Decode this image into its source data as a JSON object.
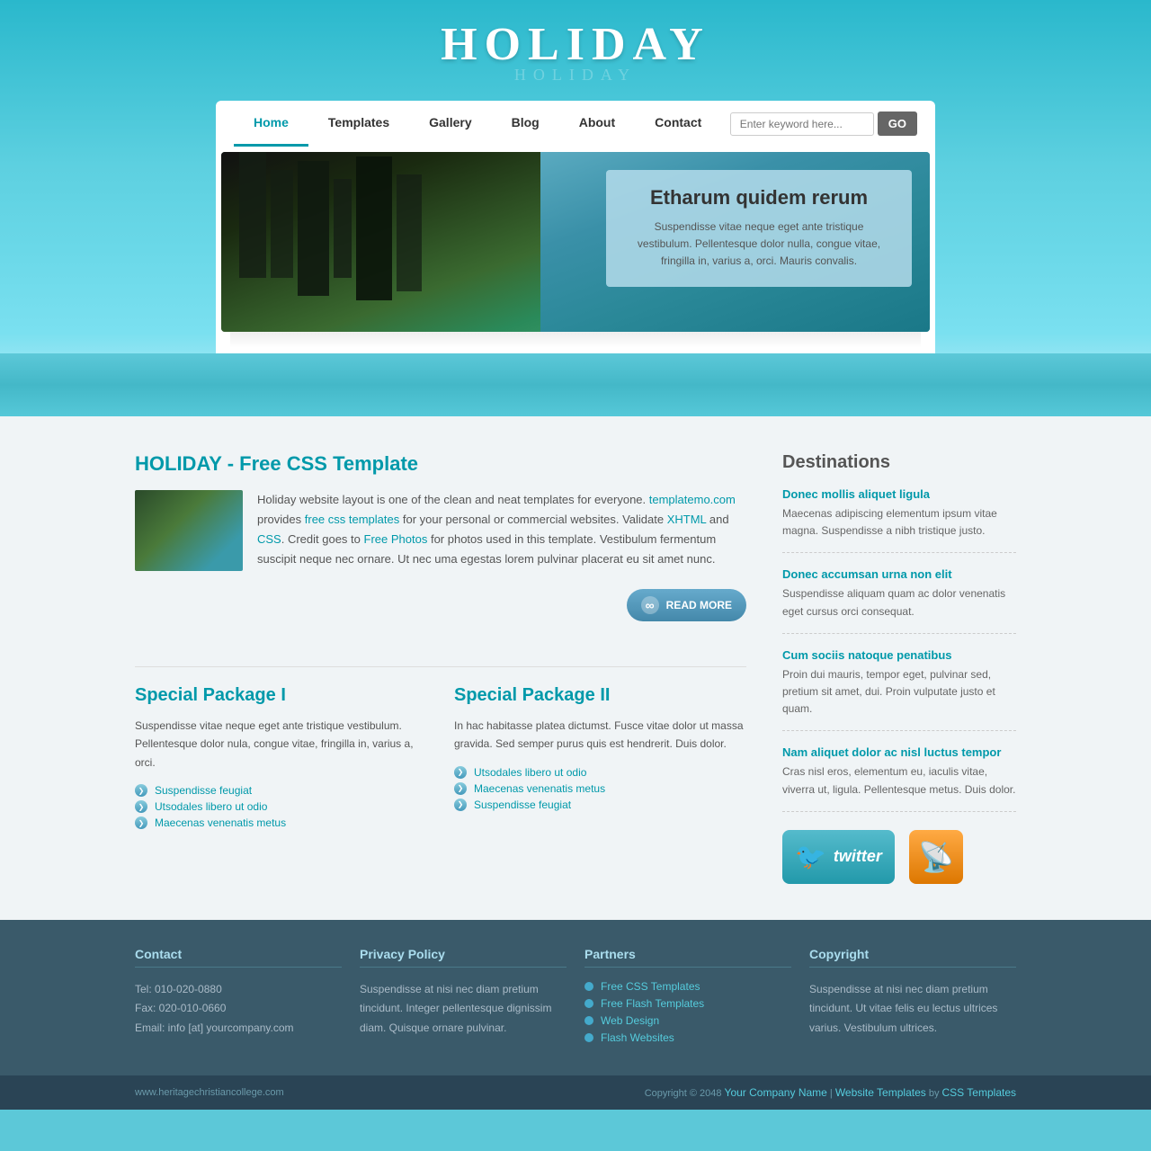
{
  "site": {
    "title": "HOLIDAY",
    "title_reflect": "HOLIDAY"
  },
  "nav": {
    "links": [
      {
        "label": "Home",
        "active": true
      },
      {
        "label": "Templates",
        "active": false
      },
      {
        "label": "Gallery",
        "active": false
      },
      {
        "label": "Blog",
        "active": false
      },
      {
        "label": "About",
        "active": false
      },
      {
        "label": "Contact",
        "active": false
      }
    ],
    "search_placeholder": "Enter keyword here...",
    "search_button": "GO"
  },
  "hero": {
    "title": "Etharum quidem rerum",
    "text": "Suspendisse vitae neque eget ante tristique vestibulum. Pellentesque dolor nulla, congue vitae, fringilla in, varius a, orci. Mauris convalis."
  },
  "article": {
    "title": "HOLIDAY - Free CSS Template",
    "body": "Holiday website layout is one of the clean and neat templates for everyone. templatemo.com provides free css templates for your personal or commercial websites. Validate XHTML and CSS. Credit goes to Free Photos for photos used in this template. Vestibulum fermentum suscipit neque nec ornare. Ut nec uma egestas lorem pulvinar placerat eu sit amet nunc.",
    "read_more": "READ MORE",
    "link_templatemo": "templatemo.com",
    "link_free_css": "free css templates",
    "link_xhtml": "XHTML",
    "link_css": "CSS",
    "link_photos": "Free Photos"
  },
  "packages": [
    {
      "title": "Special Package I",
      "text": "Suspendisse vitae neque eget ante tristique vestibulum. Pellentesque dolor nula, congue vitae, fringilla in, varius a, orci.",
      "links": [
        "Suspendisse feugiat",
        "Utsodales libero ut odio",
        "Maecenas venenatis metus"
      ]
    },
    {
      "title": "Special Package II",
      "text": "In hac habitasse platea dictumst. Fusce vitae dolor ut massa gravida. Sed semper purus quis est hendrerit. Duis dolor.",
      "links": [
        "Utsodales libero ut odio",
        "Maecenas venenatis metus",
        "Suspendisse feugiat"
      ]
    }
  ],
  "destinations": {
    "title": "Destinations",
    "items": [
      {
        "title": "Donec mollis aliquet ligula",
        "text": "Maecenas adipiscing elementum ipsum vitae magna. Suspendisse a nibh tristique justo."
      },
      {
        "title": "Donec accumsan urna non elit",
        "text": "Suspendisse aliquam quam ac dolor venenatis eget cursus orci consequat."
      },
      {
        "title": "Cum sociis natoque penatibus",
        "text": "Proin dui mauris, tempor eget, pulvinar sed, pretium sit amet, dui. Proin vulputate justo et quam."
      },
      {
        "title": "Nam aliquet dolor ac nisl luctus tempor",
        "text": "Cras nisl eros, elementum eu, iaculis vitae, viverra ut, ligula. Pellentesque metus. Duis dolor."
      }
    ]
  },
  "footer": {
    "cols": [
      {
        "title": "Contact",
        "lines": [
          "Tel: 010-020-0880",
          "Fax: 020-010-0660",
          "Email: info [at] yourcompany.com"
        ]
      },
      {
        "title": "Privacy Policy",
        "text": "Suspendisse at nisi nec diam pretium tincidunt. Integer pellentesque dignissim diam. Quisque ornare pulvinar."
      },
      {
        "title": "Partners",
        "links": [
          "Free CSS Templates",
          "Free Flash Templates",
          "Web Design",
          "Flash Websites"
        ]
      },
      {
        "title": "Copyright",
        "text": "Suspendisse at nisi nec diam pretium tincidunt. Ut vitae felis eu lectus ultrices varius. Vestibulum ultrices."
      }
    ],
    "bar": {
      "left": "www.heritagechristiancollege.com",
      "copyright": "Copyright © 2048",
      "company": "Your Company Name",
      "templates": "Website Templates",
      "by": "by",
      "css": "CSS Templates"
    }
  }
}
